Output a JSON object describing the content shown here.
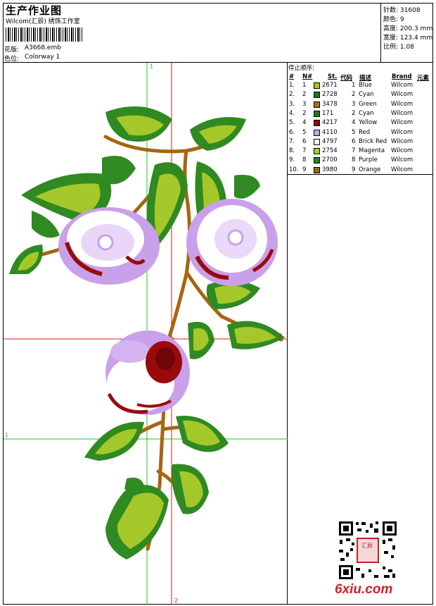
{
  "header": {
    "title": "生产作业图",
    "studio": "Wilcom(汇辰) 绣饰工作室",
    "pattern_label": "花版:",
    "pattern_value": "A3668.emb",
    "colorway_label": "色位:",
    "colorway_value": "Colorway 1"
  },
  "stats": {
    "stitches_label": "针数:",
    "stitches": "31608",
    "colors_label": "颜色:",
    "colors": "9",
    "height_label": "高度:",
    "height": "200.3 mm",
    "width_label": "宽度:",
    "width": "123.4 mm",
    "scale_label": "比例:",
    "scale": "1.08"
  },
  "sequence": {
    "title": "停止顺序:",
    "columns": [
      "#",
      "N#",
      "St.",
      "代码",
      "描述",
      "Brand",
      "元素"
    ],
    "rows": [
      {
        "idx": "1.",
        "n": "1",
        "color": "#a8c820",
        "st": "2671",
        "code": "1",
        "desc": "Blue",
        "brand": "Wilcom"
      },
      {
        "idx": "2.",
        "n": "2",
        "color": "#1e7a1e",
        "st": "2728",
        "code": "2",
        "desc": "Cyan",
        "brand": "Wilcom"
      },
      {
        "idx": "3.",
        "n": "3",
        "color": "#b56b14",
        "st": "3478",
        "code": "3",
        "desc": "Green",
        "brand": "Wilcom"
      },
      {
        "idx": "4.",
        "n": "2",
        "color": "#1e7a1e",
        "st": "171",
        "code": "2",
        "desc": "Cyan",
        "brand": "Wilcom"
      },
      {
        "idx": "5.",
        "n": "4",
        "color": "#9a0a0a",
        "st": "4217",
        "code": "4",
        "desc": "Yellow",
        "brand": "Wilcom"
      },
      {
        "idx": "6.",
        "n": "5",
        "color": "#c9a0ea",
        "st": "4110",
        "code": "5",
        "desc": "Red",
        "brand": "Wilcom"
      },
      {
        "idx": "7.",
        "n": "6",
        "color": "#ffffff",
        "st": "4797",
        "code": "6",
        "desc": "Brick Red",
        "brand": "Wilcom"
      },
      {
        "idx": "8.",
        "n": "7",
        "color": "#a8d018",
        "st": "2754",
        "code": "7",
        "desc": "Magenta",
        "brand": "Wilcom"
      },
      {
        "idx": "9.",
        "n": "8",
        "color": "#1e8a2a",
        "st": "2700",
        "code": "8",
        "desc": "Purple",
        "brand": "Wilcom"
      },
      {
        "idx": "10.",
        "n": "9",
        "color": "#9c6a10",
        "st": "3980",
        "code": "9",
        "desc": "Orange",
        "brand": "Wilcom"
      }
    ]
  },
  "guides": {
    "top": "1",
    "left": "1",
    "right": "2",
    "bottom": "2"
  },
  "watermark": "6xiu.com",
  "seal": "汇辰"
}
